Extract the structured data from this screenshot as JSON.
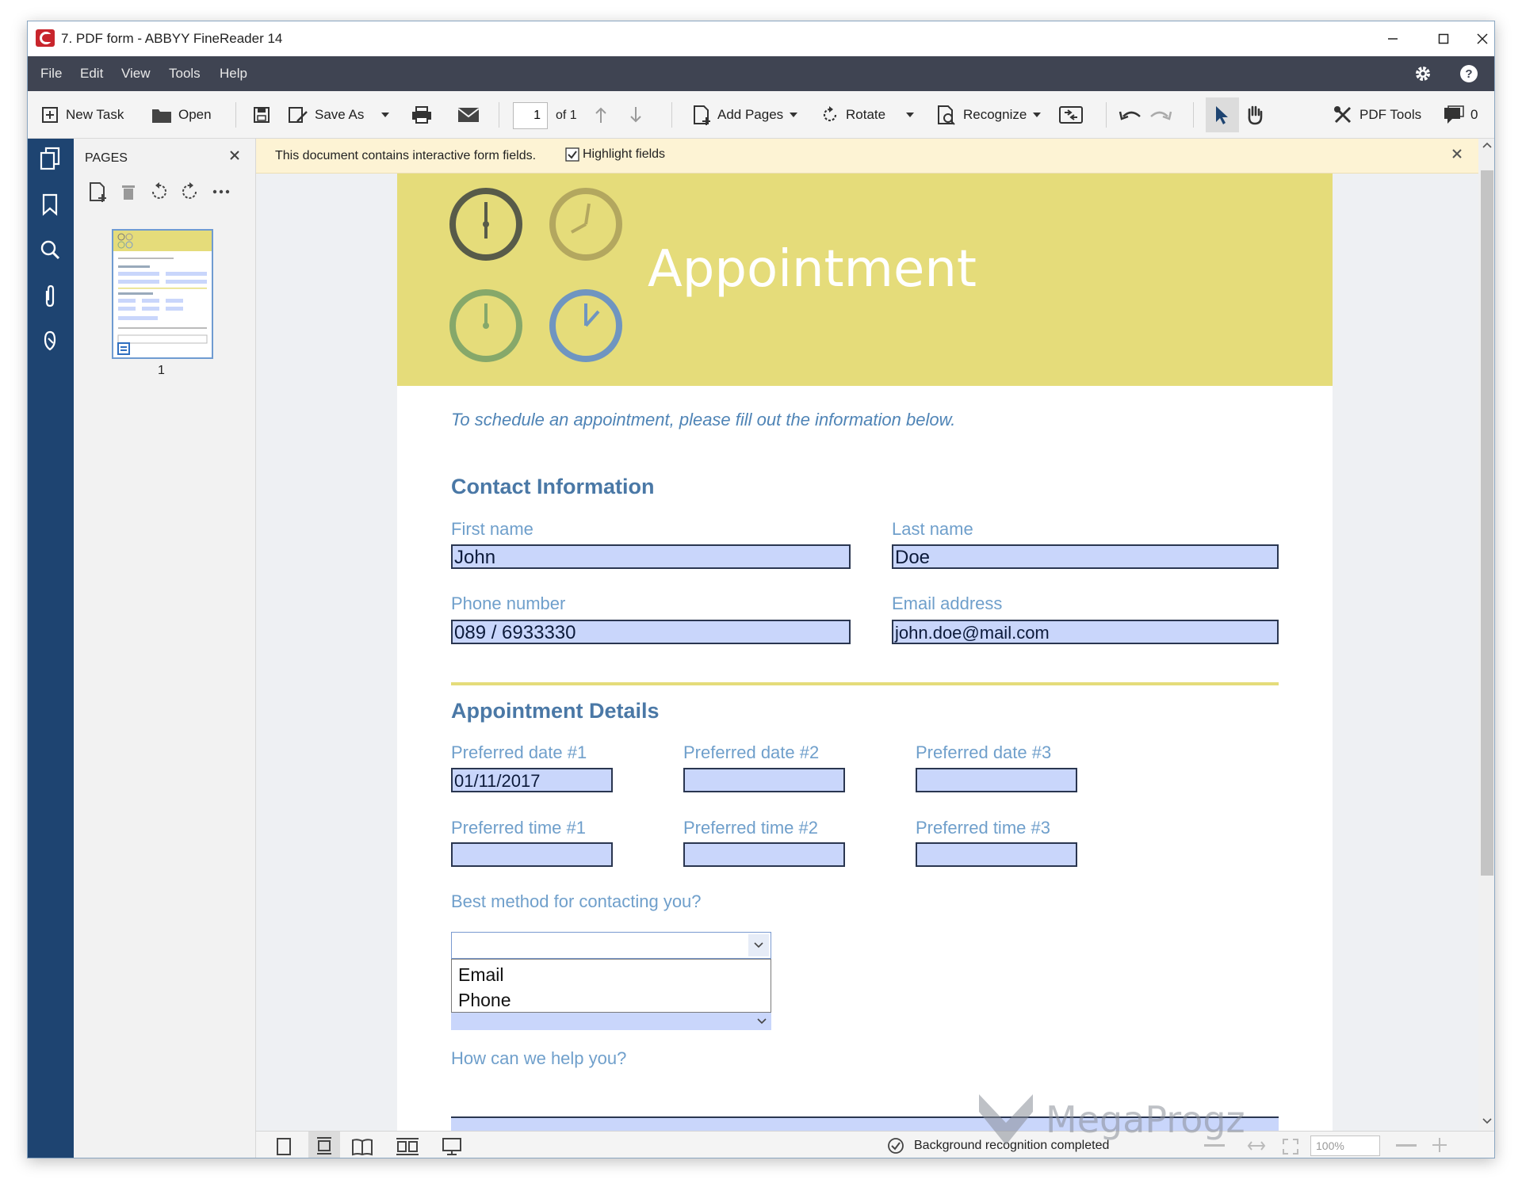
{
  "window": {
    "title": "7. PDF form - ABBYY FineReader 14",
    "controls": {
      "minimize": "minimize",
      "maximize": "maximize",
      "close": "close"
    }
  },
  "menu": {
    "items": [
      "File",
      "Edit",
      "View",
      "Tools",
      "Help"
    ]
  },
  "toolbar": {
    "new_task": "New Task",
    "open": "Open",
    "save_as": "Save As",
    "page_current": "1",
    "page_of": "of 1",
    "add_pages": "Add Pages",
    "rotate": "Rotate",
    "recognize": "Recognize",
    "pdf_tools": "PDF Tools",
    "comments_count": "0"
  },
  "pages_panel": {
    "title": "PAGES",
    "thumbnail_label": "1"
  },
  "notification": {
    "text": "This document contains interactive form fields.",
    "checkbox_label": "Highlight fields",
    "checkbox_checked": true
  },
  "document": {
    "header_title": "Appointment",
    "intro": "To schedule an appointment, please fill out the information below.",
    "contact_heading": "Contact Information",
    "first_name_label": "First name",
    "first_name_value": "John",
    "last_name_label": "Last name",
    "last_name_value": "Doe",
    "phone_label": "Phone number",
    "phone_value": "089 / 6933330",
    "email_label": "Email address",
    "email_value": "john.doe@mail.com",
    "details_heading": "Appointment Details",
    "date1_label": "Preferred date #1",
    "date1_value": "01/11/2017",
    "date2_label": "Preferred date #2",
    "date2_value": "",
    "date3_label": "Preferred date #3",
    "date3_value": "",
    "time1_label": "Preferred time #1",
    "time2_label": "Preferred time #2",
    "time3_label": "Preferred time #3",
    "contact_method_label": "Best method for contacting you?",
    "contact_method_options": [
      "Email",
      "Phone"
    ],
    "help_label": "How can we help you?"
  },
  "status": {
    "text": "Background recognition completed",
    "zoom": "100%"
  },
  "watermark": "MegaProgz",
  "colors": {
    "header_band": "#e5dc7a",
    "field_fill": "#c9d6fb",
    "label_blue": "#6f9fcb",
    "heading_blue": "#4a78a6",
    "left_strip": "#1e4471",
    "menu_bar": "#3f4452",
    "notification": "#fdf3d4"
  }
}
